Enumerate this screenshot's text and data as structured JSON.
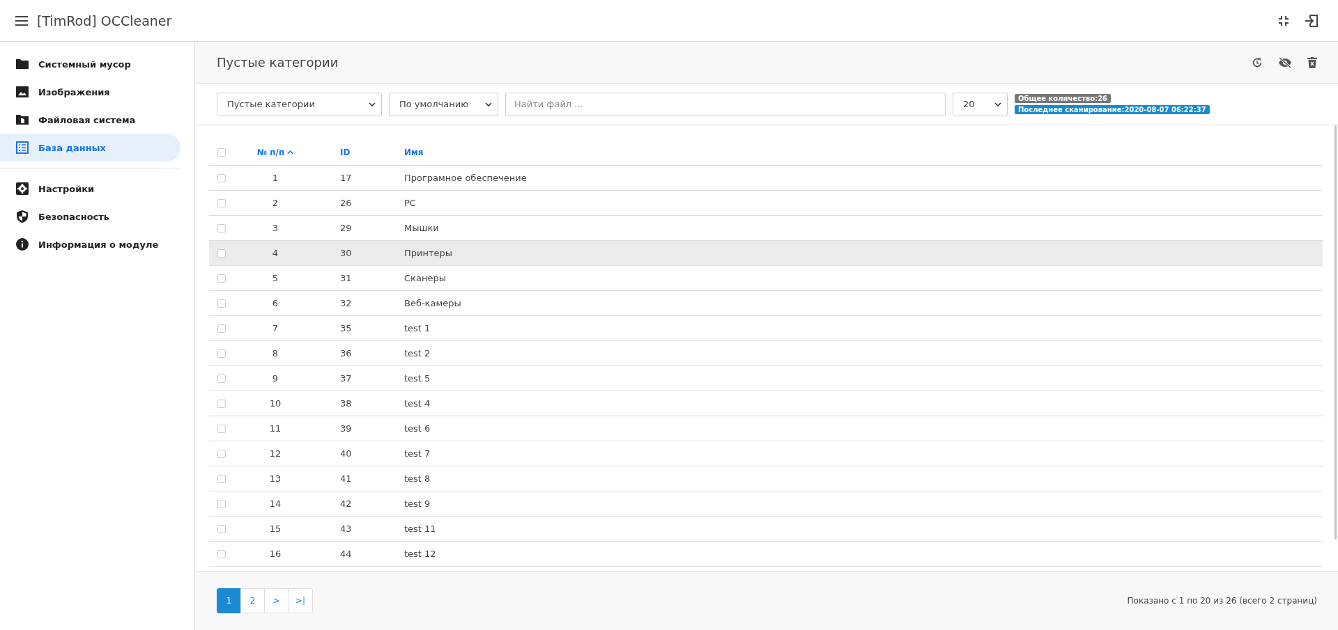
{
  "app": {
    "title": "[TimRod] OCCleaner"
  },
  "sidebar": {
    "sections": [
      {
        "items": [
          {
            "label": "Системный мусор",
            "selected": false
          },
          {
            "label": "Изображения",
            "selected": false
          },
          {
            "label": "Файловая система",
            "selected": false
          },
          {
            "label": "База данных",
            "selected": true
          }
        ]
      },
      {
        "items": [
          {
            "label": "Настройки",
            "selected": false
          },
          {
            "label": "Безопасность",
            "selected": false
          },
          {
            "label": "Информация о модуле",
            "selected": false
          }
        ]
      }
    ]
  },
  "page": {
    "title": "Пустые категории"
  },
  "filters": {
    "category": "Пустые категории",
    "sort": "По умолчанию",
    "search_placeholder": "Найти файл ...",
    "per_page": "20",
    "total_badge": "Общее количество:26",
    "scan_badge": "Последнее сканирование:2020-08-07 06:22:37"
  },
  "table": {
    "columns": [
      "№ п/п",
      "ID",
      "Имя"
    ],
    "all_checked": false,
    "rows": [
      {
        "num": "1",
        "id": "17",
        "name": "Програмное обеспечение",
        "checked": false,
        "hovered": false
      },
      {
        "num": "2",
        "id": "26",
        "name": "PC",
        "checked": false,
        "hovered": false
      },
      {
        "num": "3",
        "id": "29",
        "name": "Мышки",
        "checked": false,
        "hovered": false
      },
      {
        "num": "4",
        "id": "30",
        "name": "Принтеры",
        "checked": false,
        "hovered": true
      },
      {
        "num": "5",
        "id": "31",
        "name": "Сканеры",
        "checked": false,
        "hovered": false
      },
      {
        "num": "6",
        "id": "32",
        "name": "Веб-камеры",
        "checked": false,
        "hovered": false
      },
      {
        "num": "7",
        "id": "35",
        "name": "test 1",
        "checked": false,
        "hovered": false
      },
      {
        "num": "8",
        "id": "36",
        "name": "test 2",
        "checked": false,
        "hovered": false
      },
      {
        "num": "9",
        "id": "37",
        "name": "test 5",
        "checked": false,
        "hovered": false
      },
      {
        "num": "10",
        "id": "38",
        "name": "test 4",
        "checked": false,
        "hovered": false
      },
      {
        "num": "11",
        "id": "39",
        "name": "test 6",
        "checked": false,
        "hovered": false
      },
      {
        "num": "12",
        "id": "40",
        "name": "test 7",
        "checked": false,
        "hovered": false
      },
      {
        "num": "13",
        "id": "41",
        "name": "test 8",
        "checked": false,
        "hovered": false
      },
      {
        "num": "14",
        "id": "42",
        "name": "test 9",
        "checked": false,
        "hovered": false
      },
      {
        "num": "15",
        "id": "43",
        "name": "test 11",
        "checked": false,
        "hovered": false
      },
      {
        "num": "16",
        "id": "44",
        "name": "test 12",
        "checked": false,
        "hovered": false
      }
    ]
  },
  "pagination": {
    "pages": [
      {
        "label": "1",
        "selected": true
      },
      {
        "label": "2",
        "selected": false
      },
      {
        "label": ">",
        "selected": false
      },
      {
        "label": ">|",
        "selected": false
      }
    ],
    "summary": "Показано с 1 по 20 из 26 (всего 2 страниц)"
  }
}
